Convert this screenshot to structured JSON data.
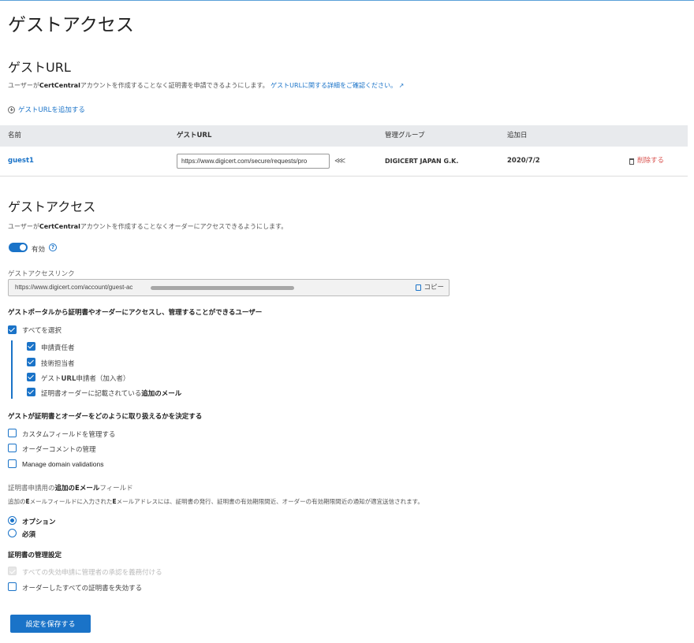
{
  "page": {
    "title": "ゲストアクセス"
  },
  "guest_url": {
    "title": "ゲストURL",
    "desc_prefix": "ユーザーが",
    "desc_bold": "CertCentral",
    "desc_suffix": "アカウントを作成することなく証明書を申請できるようにします。",
    "learn_more": "ゲストURLに関する詳細をご確認ください。",
    "add_link": "ゲストURLを追加する",
    "columns": [
      "名前",
      "ゲストURL",
      "管理グループ",
      "追加日"
    ],
    "rows": [
      {
        "name": "guest1",
        "url": "https://www.digicert.com/secure/requests/pro",
        "group": "DIGICERT JAPAN G.K.",
        "date": "2020/7/2",
        "delete": "削除する"
      }
    ]
  },
  "guest_access": {
    "title": "ゲストアクセス",
    "desc_prefix": "ユーザーが",
    "desc_bold": "CertCentral",
    "desc_suffix": "アカウントを作成することなくオーダーにアクセスできるようにします。",
    "toggle_label": "有効",
    "toggle_on": true,
    "link_label": "ゲストアクセスリンク",
    "link_value": "https://www.digicert.com/account/guest-ac",
    "copy_label": "コピー",
    "users_heading": "ゲストポータルから証明書やオーダーにアクセスし、管理することができるユーザー",
    "select_all": "すべてを選択",
    "users": [
      {
        "label": "申請責任者",
        "checked": true
      },
      {
        "label": "技術担当者",
        "checked": true
      },
      {
        "label_pre": "ゲスト",
        "label_bold": "URL",
        "label_post": "申請者（加入者）",
        "checked": true
      },
      {
        "label_pre": "証明書オーダーに記載されている",
        "label_bold": "追加のメール",
        "label_post": "",
        "checked": true
      }
    ],
    "permissions_heading": "ゲストが証明書とオーダーをどのように取り扱えるかを決定する",
    "permissions": [
      {
        "label": "カスタムフィールドを管理する",
        "checked": false
      },
      {
        "label": "オーダーコメントの管理",
        "checked": false
      },
      {
        "label": "Manage domain validations",
        "checked": false
      }
    ],
    "email_field_title_pre": "証明書申請用の",
    "email_field_title_bold": "追加のEメール",
    "email_field_title_post": "フィールド",
    "email_field_desc_pre": "追加の",
    "email_field_desc_b1": "E",
    "email_field_desc_mid": "メールフィールドに入力された",
    "email_field_desc_b2": "E",
    "email_field_desc_post": "メールアドレスには、証明書の発行、証明書の有効期限間近、オーダーの有効期限間近の通知が適宜送信されます。",
    "radio_options": [
      {
        "label": "オプション",
        "selected": true
      },
      {
        "label": "必須",
        "selected": false
      }
    ],
    "cert_mgmt_heading": "証明書の管理設定",
    "cert_mgmt": [
      {
        "label": "すべての失効申請に管理者の承認を義務付ける",
        "checked": true,
        "disabled": true
      },
      {
        "label": "オーダーしたすべての証明書を失効する",
        "checked": false,
        "disabled": false
      }
    ],
    "save_button": "設定を保存する"
  },
  "colors": {
    "accent": "#1a73c8",
    "danger": "#d9534f",
    "header_bg": "#e8eaed"
  }
}
